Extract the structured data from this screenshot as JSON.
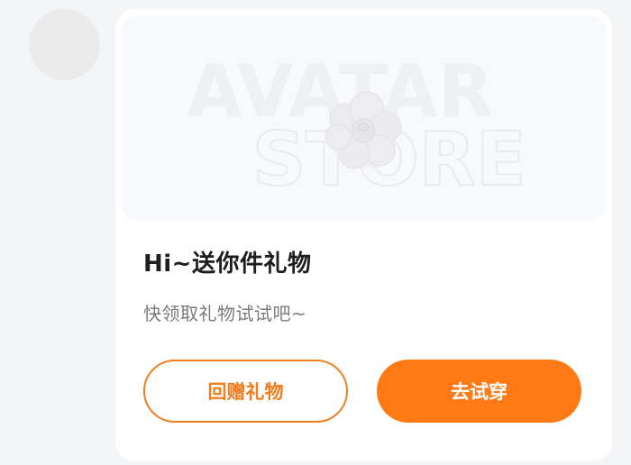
{
  "banner": {
    "watermark_line1": "AVATAR",
    "watermark_line2": "STORE",
    "gift_icon": "flower-bouquet-icon"
  },
  "card": {
    "title": "Hi~送你件礼物",
    "subtitle": "快领取礼物试试吧~"
  },
  "actions": {
    "return_gift_label": "回赠礼物",
    "try_on_label": "去试穿"
  },
  "colors": {
    "accent": "#ff7a14",
    "outline": "#f07d1e",
    "background": "#f4f5f7"
  }
}
